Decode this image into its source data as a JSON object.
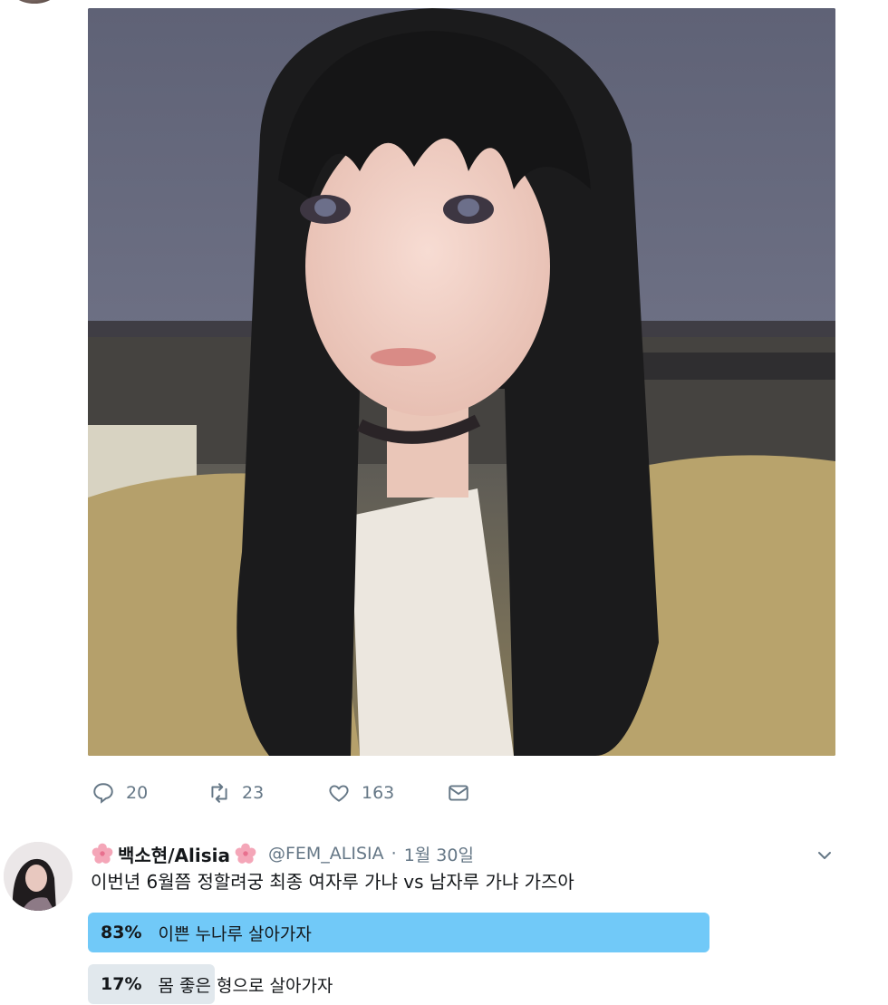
{
  "media": {
    "alt": "selfie photo"
  },
  "actions": {
    "reply_count": "20",
    "retweet_count": "23",
    "like_count": "163"
  },
  "tweet": {
    "display_name": "백소현/Alisia",
    "handle": "@FEM_ALISIA",
    "separator": "·",
    "date": "1월 30일",
    "text": "이번년 6월쯤 정할려궁 최종 여자루 가냐 vs 남자루 가냐 가즈아"
  },
  "poll": {
    "options": [
      {
        "percent": "83%",
        "label": "이쁜 누나루 살아가자",
        "value": 0.83,
        "leading": true
      },
      {
        "percent": "17%",
        "label": "몸 좋은 형으로 살아가자",
        "value": 0.17,
        "leading": false
      }
    ]
  },
  "colors": {
    "poll_leading": "#71c9f8",
    "poll_other": "#e1e8ed",
    "secondary_text": "#657786",
    "flower": "#f4a6b8"
  },
  "icons": [
    "reply-icon",
    "retweet-icon",
    "like-icon",
    "direct-message-icon",
    "cherry-blossom-icon",
    "chevron-down-icon"
  ]
}
